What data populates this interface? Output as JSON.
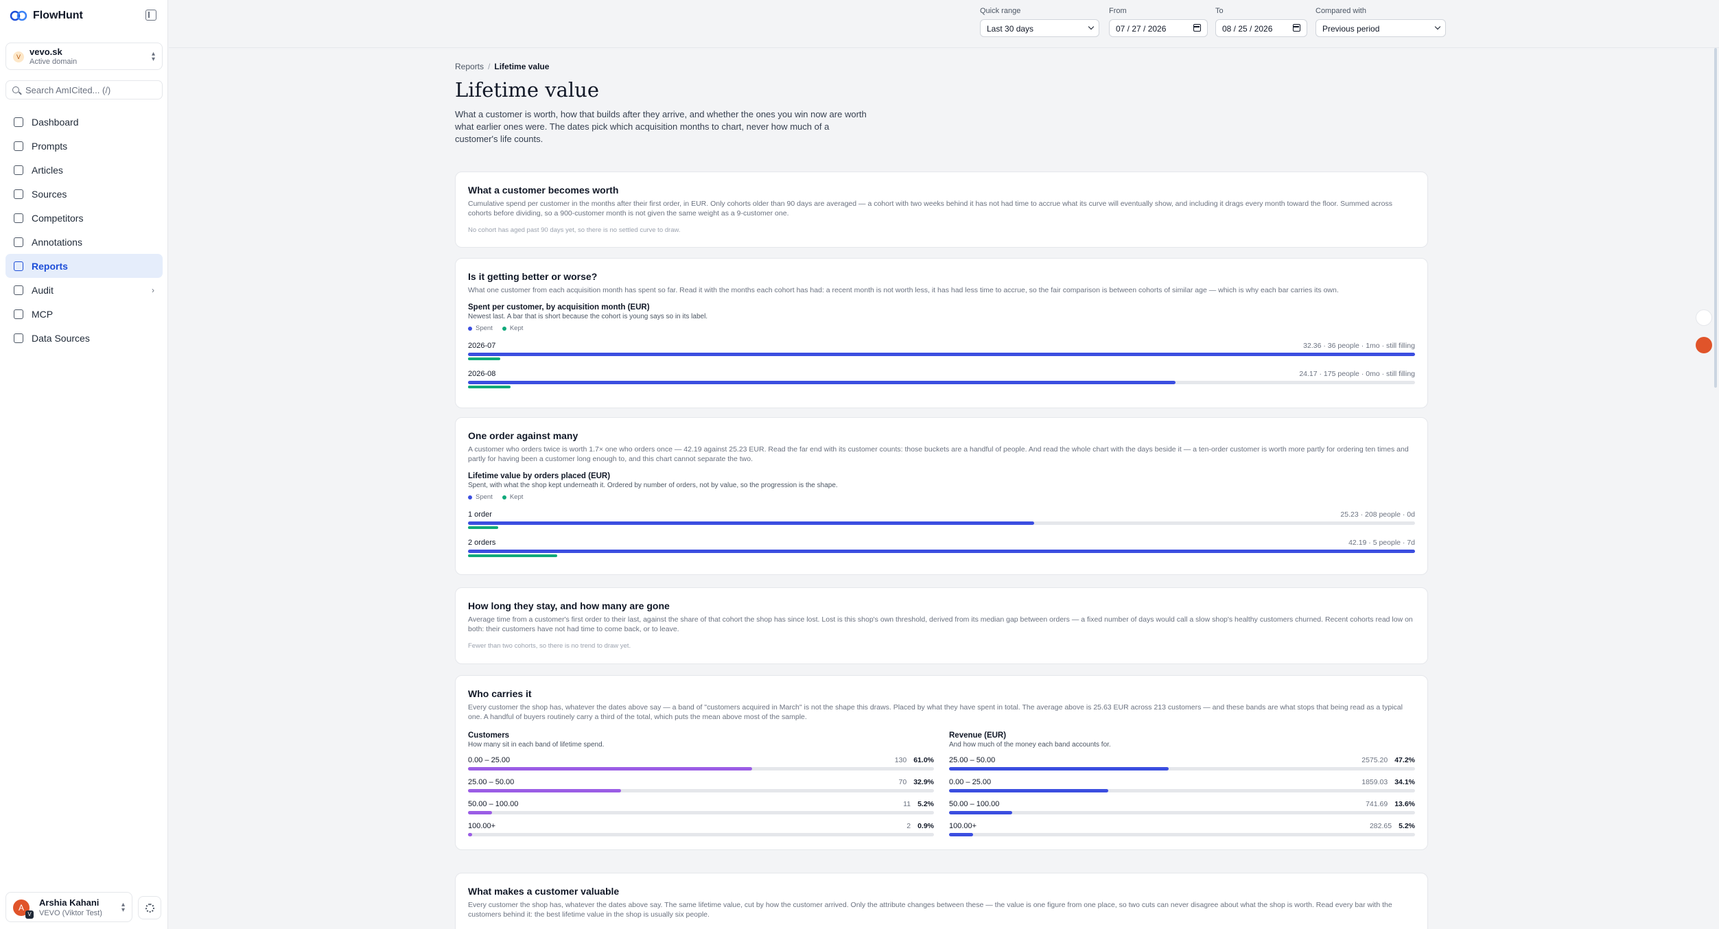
{
  "app": {
    "name": "FlowHunt"
  },
  "domain": {
    "name": "vevo.sk",
    "status": "Active domain",
    "initial": "V"
  },
  "search": {
    "placeholder": "Search AmICited... (/)"
  },
  "nav": [
    {
      "label": "Dashboard",
      "icon": "dashboard-icon"
    },
    {
      "label": "Prompts",
      "icon": "prompts-icon"
    },
    {
      "label": "Articles",
      "icon": "articles-icon"
    },
    {
      "label": "Sources",
      "icon": "sources-icon"
    },
    {
      "label": "Competitors",
      "icon": "competitors-icon"
    },
    {
      "label": "Annotations",
      "icon": "annotations-icon"
    },
    {
      "label": "Reports",
      "icon": "reports-icon",
      "active": true
    },
    {
      "label": "Audit",
      "icon": "audit-icon",
      "has_children": true
    },
    {
      "label": "MCP",
      "icon": "mcp-icon"
    },
    {
      "label": "Data Sources",
      "icon": "data-sources-icon"
    }
  ],
  "user": {
    "name": "Arshia Kahani",
    "org": "VEVO (Viktor Test)",
    "initial": "A",
    "badge": "V"
  },
  "filters": {
    "quick_range": {
      "label": "Quick range",
      "value": "Last 30 days"
    },
    "from": {
      "label": "From",
      "value": "07 / 27 / 2026"
    },
    "to": {
      "label": "To",
      "value": "08 / 25 / 2026"
    },
    "compared": {
      "label": "Compared with",
      "value": "Previous period"
    }
  },
  "breadcrumb": {
    "parent": "Reports",
    "current": "Lifetime value"
  },
  "page": {
    "title": "Lifetime value",
    "description": "What a customer is worth, how that builds after they arrive, and whether the ones you win now are worth what earlier ones were. The dates pick which acquisition months to chart, never how much of a customer's life counts."
  },
  "colors": {
    "spent": "#3b4ee0",
    "kept": "#0ea97a",
    "customers": "#9b5de5",
    "revenue": "#3b4ee0",
    "active_nav": "#1d4ed8"
  },
  "sections": {
    "worth": {
      "title": "What a customer becomes worth",
      "description": "Cumulative spend per customer in the months after their first order, in EUR. Only cohorts older than 90 days are averaged — a cohort with two weeks behind it has not had time to accrue what its curve will eventually show, and including it drags every month toward the floor. Summed across cohorts before dividing, so a 900-customer month is not given the same weight as a 9-customer one.",
      "note": "No cohort has aged past 90 days yet, so there is no settled curve to draw."
    },
    "better": {
      "title": "Is it getting better or worse?",
      "description": "What one customer from each acquisition month has spent so far. Read it with the months each cohort has had: a recent month is not worth less, it has had less time to accrue, so the fair comparison is between cohorts of similar age — which is why each bar carries its own.",
      "chart_title": "Spent per customer, by acquisition month (EUR)",
      "chart_sub": "Newest last. A bar that is short because the cohort is young says so in its label.",
      "legend_spent": "Spent",
      "legend_kept": "Kept",
      "rows": [
        {
          "label": "2026-07",
          "meta": "32.36 · 36 people · 1mo · still filling",
          "spent": 1.0,
          "kept": 0.034
        },
        {
          "label": "2026-08",
          "meta": "24.17 · 175 people · 0mo · still filling",
          "spent": 0.747,
          "kept": 0.045
        }
      ]
    },
    "orders": {
      "title": "One order against many",
      "description": "A customer who orders twice is worth 1.7× one who orders once — 42.19 against 25.23 EUR. Read the far end with its customer counts: those buckets are a handful of people. And read the whole chart with the days beside it — a ten-order customer is worth more partly for ordering ten times and partly for having been a customer long enough to, and this chart cannot separate the two.",
      "chart_title": "Lifetime value by orders placed (EUR)",
      "chart_sub": "Spent, with what the shop kept underneath it. Ordered by number of orders, not by value, so the progression is the shape.",
      "legend_spent": "Spent",
      "legend_kept": "Kept",
      "rows": [
        {
          "label": "1 order",
          "meta": "25.23 · 208 people · 0d",
          "spent": 0.598,
          "kept": 0.032
        },
        {
          "label": "2 orders",
          "meta": "42.19 · 5 people · 7d",
          "spent": 1.0,
          "kept": 0.094
        }
      ]
    },
    "stay": {
      "title": "How long they stay, and how many are gone",
      "description": "Average time from a customer's first order to their last, against the share of that cohort the shop has since lost. Lost is this shop's own threshold, derived from its median gap between orders — a fixed number of days would call a slow shop's healthy customers churned. Recent cohorts read low on both: their customers have not had time to come back, or to leave.",
      "note": "Fewer than two cohorts, so there is no trend to draw yet."
    },
    "carries": {
      "title": "Who carries it",
      "description": "Every customer the shop has, whatever the dates above say — a band of \"customers acquired in March\" is not the shape this draws. Placed by what they have spent in total. The average above is 25.63 EUR across 213 customers — and these bands are what stops that being read as a typical one. A handful of buyers routinely carry a third of the total, which puts the mean above most of the sample.",
      "customers": {
        "title": "Customers",
        "sub": "How many sit in each band of lifetime spend.",
        "rows": [
          {
            "label": "0.00 – 25.00",
            "count": "130",
            "pct": "61.0%",
            "fill": 0.61
          },
          {
            "label": "25.00 – 50.00",
            "count": "70",
            "pct": "32.9%",
            "fill": 0.329
          },
          {
            "label": "50.00 – 100.00",
            "count": "11",
            "pct": "5.2%",
            "fill": 0.052
          },
          {
            "label": "100.00+",
            "count": "2",
            "pct": "0.9%",
            "fill": 0.009
          }
        ]
      },
      "revenue": {
        "title": "Revenue (EUR)",
        "sub": "And how much of the money each band accounts for.",
        "rows": [
          {
            "label": "25.00 – 50.00",
            "count": "2575.20",
            "pct": "47.2%",
            "fill": 0.472
          },
          {
            "label": "0.00 – 25.00",
            "count": "1859.03",
            "pct": "34.1%",
            "fill": 0.341
          },
          {
            "label": "50.00 – 100.00",
            "count": "741.69",
            "pct": "13.6%",
            "fill": 0.136
          },
          {
            "label": "100.00+",
            "count": "282.65",
            "pct": "5.2%",
            "fill": 0.052
          }
        ]
      }
    },
    "valuable": {
      "title": "What makes a customer valuable",
      "description": "Every customer the shop has, whatever the dates above say. The same lifetime value, cut by how the customer arrived. Only the attribute changes between these — the value is one figure from one place, so two cuts can never disagree about what the shop is worth. Read every bar with the customers behind it: the best lifetime value in the shop is usually six people."
    }
  }
}
